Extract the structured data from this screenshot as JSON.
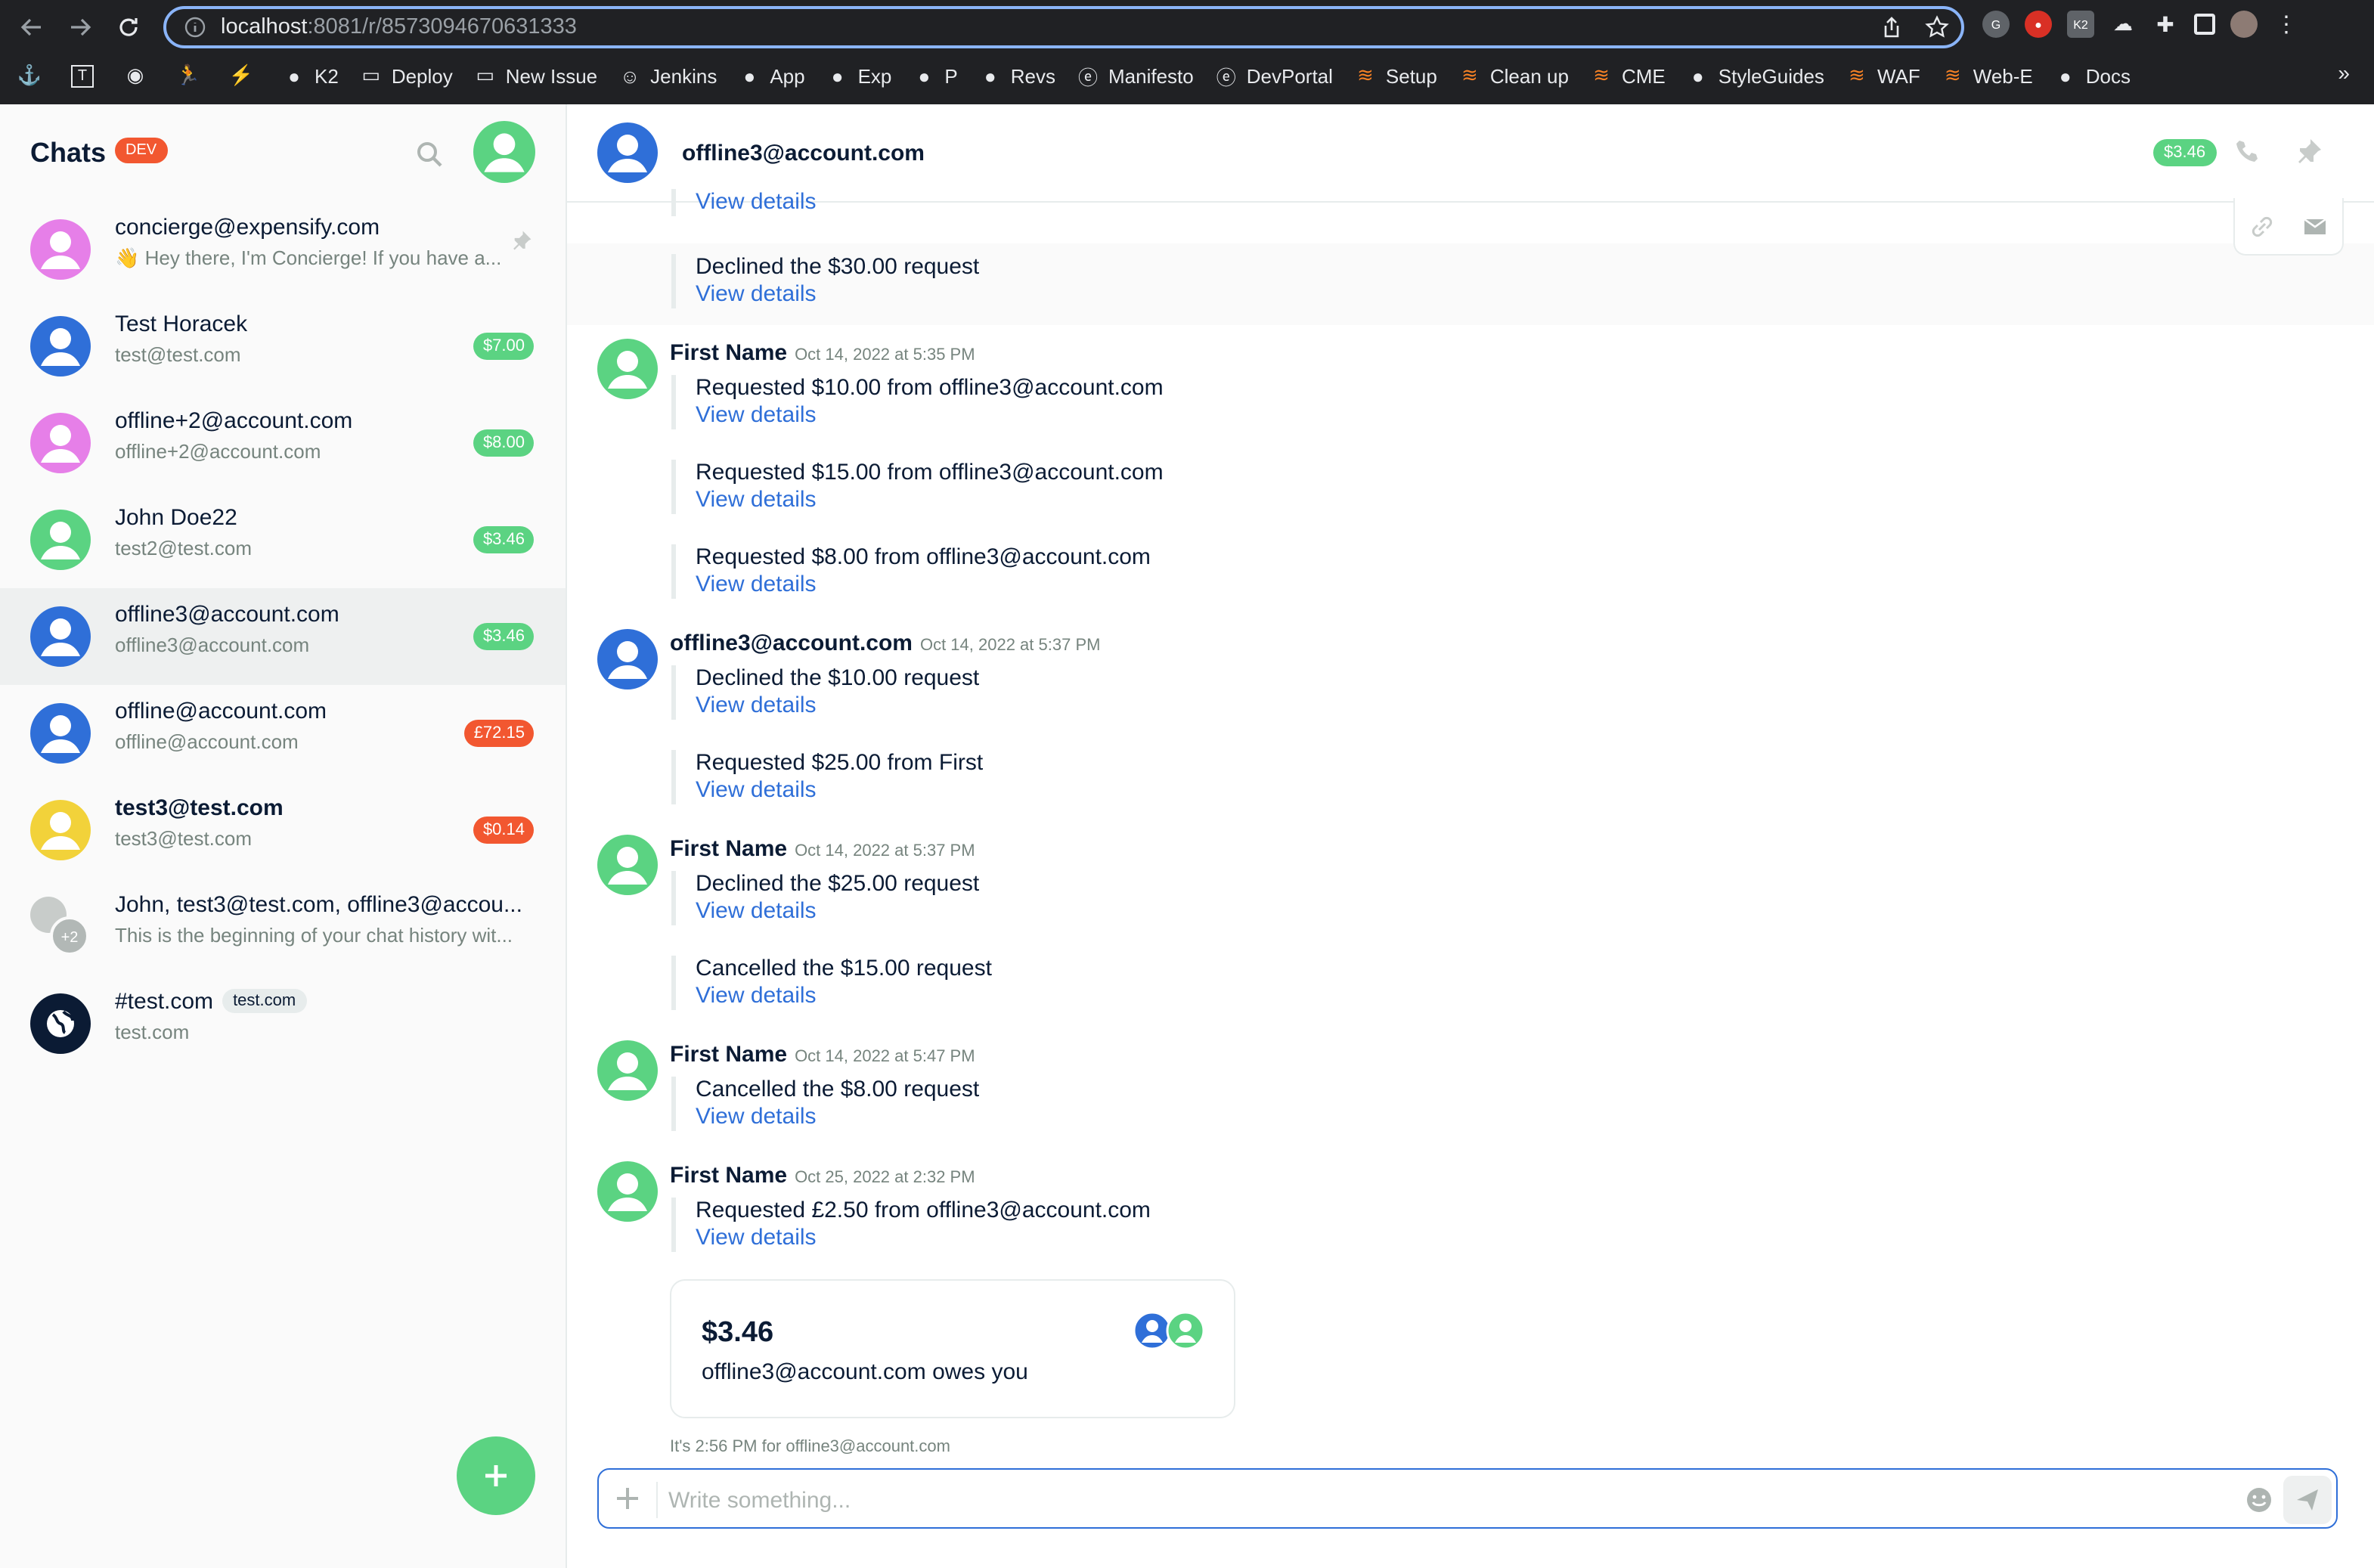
{
  "browser": {
    "url_host": "localhost",
    "url_path": ":8081/r/8573094670631333",
    "bookmarks": [
      "K2",
      "Deploy",
      "New Issue",
      "Jenkins",
      "App",
      "Exp",
      "P",
      "Revs",
      "Manifesto",
      "DevPortal",
      "Setup",
      "Clean up",
      "CME",
      "StyleGuides",
      "WAF",
      "Web-E",
      "Docs"
    ],
    "more": "»"
  },
  "sidebar": {
    "title": "Chats",
    "badge": "DEV",
    "chats": [
      {
        "name": "concierge@expensify.com",
        "sub": "👋 Hey there, I'm Concierge! If you have a...",
        "amount": "",
        "pinned": true,
        "avatar_color": "#e67fe8",
        "bold": false
      },
      {
        "name": "Test Horacek",
        "sub": "test@test.com",
        "amount": "$7.00",
        "amount_color": "green",
        "avatar_color": "#2f6fd8",
        "bold": false
      },
      {
        "name": "offline+2@account.com",
        "sub": "offline+2@account.com",
        "amount": "$8.00",
        "amount_color": "green",
        "avatar_color": "#e67fe8",
        "bold": false
      },
      {
        "name": "John Doe22",
        "sub": "test2@test.com",
        "amount": "$3.46",
        "amount_color": "green",
        "avatar_color": "#5bd382",
        "bold": false
      },
      {
        "name": "offline3@account.com",
        "sub": "offline3@account.com",
        "amount": "$3.46",
        "amount_color": "green",
        "avatar_color": "#2f6fd8",
        "bold": false,
        "active": true
      },
      {
        "name": "offline@account.com",
        "sub": "offline@account.com",
        "amount": "£72.15",
        "amount_color": "red",
        "avatar_color": "#2f6fd8",
        "bold": false
      },
      {
        "name": "test3@test.com",
        "sub": "test3@test.com",
        "amount": "$0.14",
        "amount_color": "red",
        "avatar_color": "#f2d23a",
        "bold": true
      },
      {
        "name": "John, test3@test.com, offline3@accou...",
        "sub": "This is the beginning of your chat history wit...",
        "amount": "",
        "avatar_color": "#c8ccca",
        "group_count": "+2",
        "bold": false
      },
      {
        "name": "#test.com",
        "pill": "test.com",
        "sub": "test.com",
        "amount": "",
        "avatar_color": "#0b1b34",
        "bold": false
      }
    ]
  },
  "header": {
    "title": "offline3@account.com",
    "amount": "$3.46"
  },
  "messages": {
    "top_view": "View details",
    "highlight_text": "Declined the $30.00 request",
    "view": "View details",
    "groups": [
      {
        "sender": "First Name",
        "time": "Oct 14, 2022 at 5:35 PM",
        "color": "#5bd382",
        "items": [
          "Requested $10.00 from offline3@account.com",
          "Requested $15.00 from offline3@account.com",
          "Requested $8.00 from offline3@account.com"
        ]
      },
      {
        "sender": "offline3@account.com",
        "time": "Oct 14, 2022 at 5:37 PM",
        "color": "#2f6fd8",
        "items": [
          "Declined the $10.00 request",
          "Requested $25.00 from First"
        ]
      },
      {
        "sender": "First Name",
        "time": "Oct 14, 2022 at 5:37 PM",
        "color": "#5bd382",
        "items": [
          "Declined the $25.00 request",
          "Cancelled the $15.00 request"
        ]
      },
      {
        "sender": "First Name",
        "time": "Oct 14, 2022 at 5:47 PM",
        "color": "#5bd382",
        "items": [
          "Cancelled the $8.00 request"
        ]
      },
      {
        "sender": "First Name",
        "time": "Oct 25, 2022 at 2:32 PM",
        "color": "#5bd382",
        "items": [
          "Requested £2.50 from offline3@account.com"
        ]
      }
    ]
  },
  "iou_card": {
    "amount": "$3.46",
    "description": "offline3@account.com owes you"
  },
  "timezone_note": "It's 2:56 PM for offline3@account.com",
  "composer": {
    "placeholder": "Write something..."
  },
  "colors": {
    "green": "#5bd382",
    "red": "#f25730",
    "link": "#2f6fd8"
  }
}
